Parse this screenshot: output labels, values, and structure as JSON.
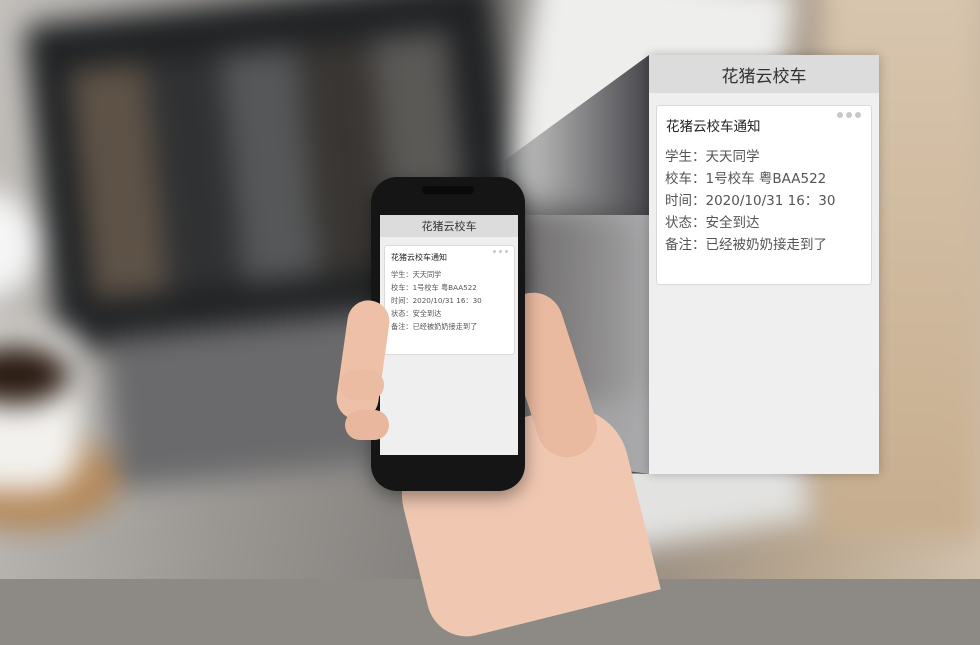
{
  "app": {
    "title": "花猪云校车"
  },
  "notification": {
    "title": "花猪云校车通知",
    "more_icon": "more-dots-icon",
    "lines": [
      "学生：天天同学",
      "校车：1号校车   粤BAA522",
      "时间：2020/10/31   16：30",
      "状态：安全到达",
      "备注：已经被奶奶接走到了"
    ]
  }
}
